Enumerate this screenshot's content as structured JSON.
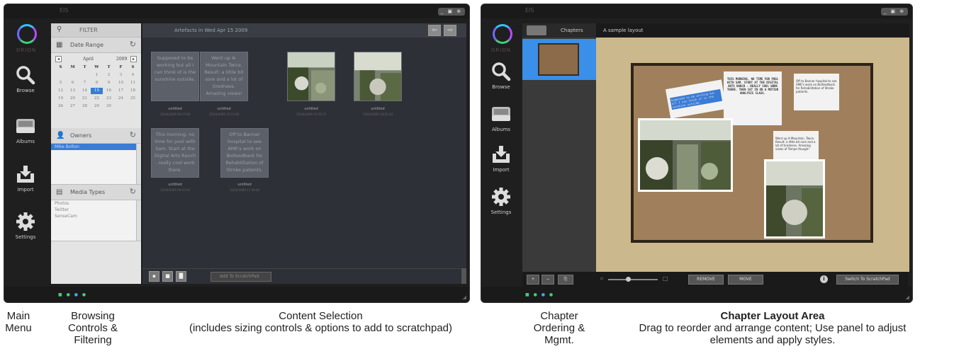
{
  "left_window": {
    "title": "EIS",
    "window_controls": "_ ▣ ⊗",
    "logo_text": "ORION",
    "menu": [
      {
        "label": "Browse",
        "icon": "search-icon"
      },
      {
        "label": "Albums",
        "icon": "inbox-icon"
      },
      {
        "label": "Import",
        "icon": "import-icon"
      },
      {
        "label": "Settings",
        "icon": "gear-icon"
      }
    ],
    "filter": {
      "search_placeholder": "FILTER",
      "date_range_label": "Date Range",
      "calendar": {
        "month": "April",
        "year": "2009",
        "prev": "◂",
        "next": "▸",
        "day_headers": [
          "S",
          "M",
          "T",
          "W",
          "T",
          "F",
          "S"
        ],
        "days": [
          "",
          "",
          "",
          "1",
          "2",
          "3",
          "4",
          "5",
          "6",
          "7",
          "8",
          "9",
          "10",
          "11",
          "12",
          "13",
          "14",
          "15",
          "16",
          "17",
          "18",
          "19",
          "20",
          "21",
          "22",
          "23",
          "24",
          "25",
          "26",
          "27",
          "28",
          "29",
          "30",
          "",
          ""
        ],
        "selected_day": "15"
      },
      "owners_label": "Owners",
      "owners": [
        "Mike Bolton"
      ],
      "media_types_label": "Media Types",
      "media_types": [
        "Photos",
        "Twitter",
        "SenseCam"
      ]
    },
    "content": {
      "header": "Artefacts in Wed Apr 15 2009",
      "tiles": [
        {
          "text": "Supposed to be working but all I can think of is the sunshine outside.",
          "title": "untitled",
          "date": "15/04/2009 09:27:00"
        },
        {
          "text": "Went up A-Mountain Twice. Result: a little bit sore and a lot of tiredness. Amazing views!",
          "title": "untitled",
          "date": "15/04/2009 10:15:00"
        },
        {
          "text": "",
          "title": "untitled",
          "date": "15/04/2009 10:55:37"
        },
        {
          "text": "",
          "title": "untitled",
          "date": "15/04/2009 10:55:40"
        },
        {
          "text": "This morning, no time for pool with Sam. Start at the Digital Arts Ranch - really cool work there.",
          "title": "untitled",
          "date": "15/04/2009 09:47:44"
        },
        {
          "text": "Off to Banner hospital to see AME's work on Biofeedback for Rehabilitation of Stroke patients.",
          "title": "untitled",
          "date": "15/04/2009 11:36:40"
        }
      ],
      "add_to_scratchpad": "Add To ScratchPad"
    }
  },
  "right_window": {
    "title": "EIS",
    "window_controls": "_ ▣ ⊗",
    "logo_text": "ORION",
    "menu": [
      {
        "label": "Browse",
        "icon": "search-icon"
      },
      {
        "label": "Albums",
        "icon": "inbox-icon"
      },
      {
        "label": "Import",
        "icon": "import-icon"
      },
      {
        "label": "Settings",
        "icon": "gear-icon"
      }
    ],
    "chapters_label": "Chapters",
    "layout_title": "A sample layout",
    "notes": [
      "THIS MORNING, NO TIME FOR POOL WITH SAM. START AT THE DIGITAL ARTS RANCH - REALLY COOL WORK THERE. THEN CAT IN ON A MOTION ANALYSIS CLASS.",
      "Off to Banner hospital to see AME's work on Biofeedback for Rehabilitation of Stroke patients.",
      "Went up A-Mountain. Twice. Result: a little bit sore and a lot of tiredness. Amazing views of Tempe though!",
      "Supposed to be working but all I can think of is the sunshine outside."
    ],
    "remove_label": "REMOVE",
    "move_label": "MOVE",
    "switch_label": "Switch To ScratchPad"
  },
  "captions": [
    {
      "text": "Main Menu",
      "bold": false
    },
    {
      "text": "Browsing Controls & Filtering",
      "bold": false
    },
    {
      "title": "Content Selection",
      "text": "(includes sizing controls & options to add to scratchpad)",
      "bold": false
    },
    {
      "text": "Chapter Ordering & Mgmt.",
      "bold": false
    },
    {
      "title": "Chapter Layout Area",
      "text": "Drag to reorder and arrange content; Use panel to adjust elements and apply styles.",
      "bold": true
    }
  ],
  "colors": {
    "accent": "#3a8fe8",
    "cork": "#a0805c",
    "layout_bg": "#cbb88d"
  }
}
